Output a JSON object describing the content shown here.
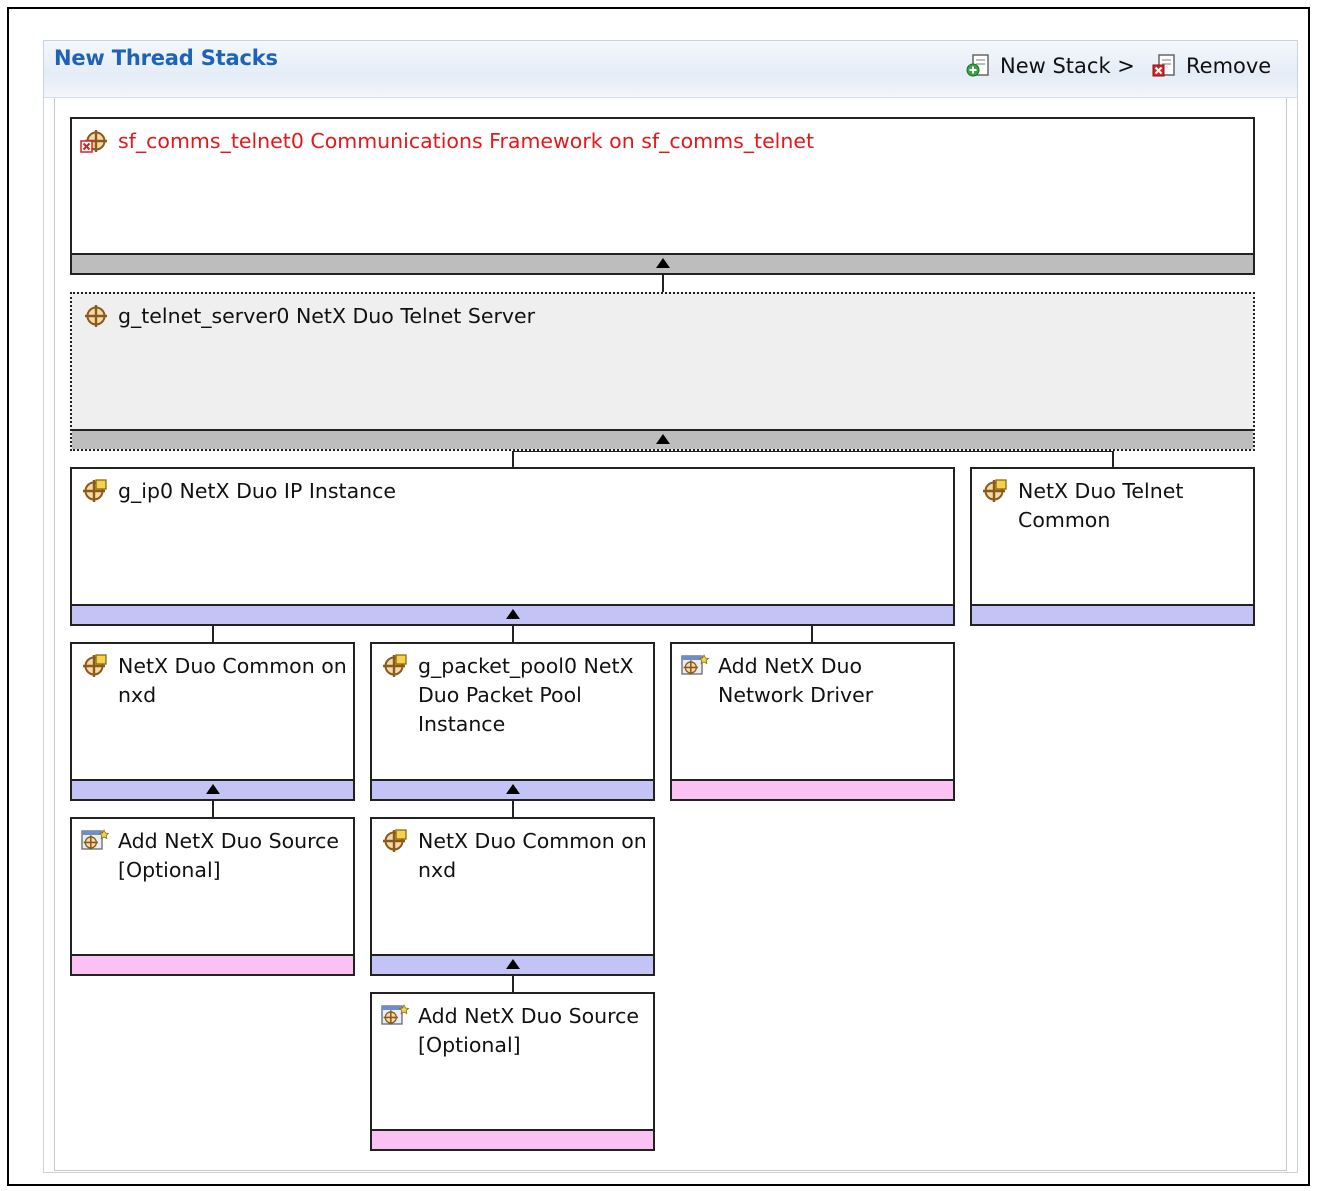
{
  "panel": {
    "title": "New Thread Stacks",
    "new_stack_label": "New Stack >",
    "remove_label": "Remove"
  },
  "colors": {
    "title_blue": "#1f63b8",
    "error_red": "#e3181b",
    "bar_gray": "#bdbdbd",
    "bar_blue": "#c3c3f6",
    "bar_pink": "#fbc1f3"
  },
  "nodes": {
    "comms_framework": {
      "label": "sf_comms_telnet0 Communications Framework on sf_comms_telnet",
      "icon": "module-error-icon"
    },
    "telnet_server": {
      "label": "g_telnet_server0 NetX Duo Telnet Server",
      "icon": "module-icon"
    },
    "ip_instance": {
      "label": "g_ip0 NetX Duo IP Instance",
      "icon": "module-config-icon"
    },
    "telnet_common": {
      "label": "NetX Duo Telnet Common",
      "icon": "module-config-icon"
    },
    "netx_common_1": {
      "label": "NetX Duo Common on nxd",
      "icon": "module-config-icon"
    },
    "packet_pool": {
      "label": "g_packet_pool0 NetX Duo Packet Pool Instance",
      "icon": "module-config-icon"
    },
    "network_driver": {
      "label": "Add NetX Duo Network Driver",
      "icon": "add-module-icon"
    },
    "source_1": {
      "label": "Add NetX Duo Source [Optional]",
      "icon": "add-module-icon"
    },
    "netx_common_2": {
      "label": "NetX Duo Common on nxd",
      "icon": "module-config-icon"
    },
    "source_2": {
      "label": "Add NetX Duo Source [Optional]",
      "icon": "add-module-icon"
    }
  }
}
